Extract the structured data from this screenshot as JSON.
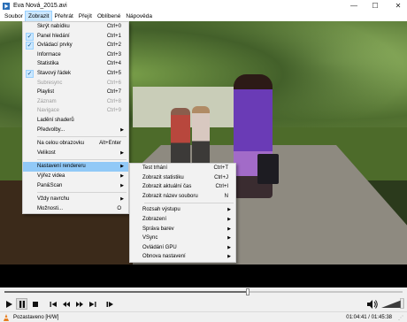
{
  "window": {
    "title": "Eva Nová_2015.avi",
    "minimize": "—",
    "maximize": "☐",
    "close": "✕"
  },
  "menubar": [
    "Soubor",
    "Zobrazit",
    "Přehrát",
    "Přejít",
    "Oblíbené",
    "Nápověda"
  ],
  "main_menu": [
    {
      "label": "Skrýt nabídku",
      "shortcut": "Ctrl+0"
    },
    {
      "label": "Panel hledání",
      "shortcut": "Ctrl+1",
      "checked": true
    },
    {
      "label": "Ovládací prvky",
      "shortcut": "Ctrl+2",
      "checked": true
    },
    {
      "label": "Informace",
      "shortcut": "Ctrl+3"
    },
    {
      "label": "Statistika",
      "shortcut": "Ctrl+4"
    },
    {
      "label": "Stavový řádek",
      "shortcut": "Ctrl+5",
      "checked": true
    },
    {
      "label": "Subresync",
      "shortcut": "Ctrl+6",
      "disabled": true
    },
    {
      "label": "Playlist",
      "shortcut": "Ctrl+7"
    },
    {
      "label": "Záznam",
      "shortcut": "Ctrl+8",
      "disabled": true
    },
    {
      "label": "Navigace",
      "shortcut": "Ctrl+9",
      "disabled": true
    },
    {
      "label": "Ladění shaderů"
    },
    {
      "label": "Předvolby...",
      "submenu": true
    },
    {
      "separator": true
    },
    {
      "label": "Na celou obrazovku",
      "shortcut": "Alt+Enter"
    },
    {
      "label": "Velikost",
      "submenu": true
    },
    {
      "separator": true
    },
    {
      "label": "Nastavení rendereru",
      "submenu": true,
      "highlighted": true
    },
    {
      "label": "Výřez videa",
      "submenu": true
    },
    {
      "label": "Pan&Scan",
      "submenu": true
    },
    {
      "separator": true
    },
    {
      "label": "Vždy navrchu",
      "submenu": true
    },
    {
      "label": "Možnosti...",
      "shortcut": "O"
    }
  ],
  "renderer_menu": [
    {
      "label": "Test trhání",
      "shortcut": "Ctrl+T"
    },
    {
      "label": "Zobrazit statistiku",
      "shortcut": "Ctrl+J"
    },
    {
      "label": "Zobrazit aktuální čas",
      "shortcut": "Ctrl+I"
    },
    {
      "label": "Zobrazit název souboru",
      "shortcut": "N"
    },
    {
      "separator": true
    },
    {
      "label": "Rozsah výstupu",
      "submenu": true
    },
    {
      "label": "Zobrazení",
      "submenu": true
    },
    {
      "label": "Správa barev",
      "submenu": true
    },
    {
      "label": "VSync",
      "submenu": true
    },
    {
      "label": "Ovládání GPU",
      "submenu": true
    },
    {
      "label": "Obnova nastavení",
      "submenu": true
    }
  ],
  "player": {
    "progress": 0.61,
    "volume": 0.9,
    "status_text": "Pozastaveno [H/W]",
    "time_display": "01:04:41 / 01:45:38",
    "controls": [
      "play-icon",
      "pause-icon",
      "stop-icon",
      "prev-icon",
      "rewind-icon",
      "forward-icon",
      "next-icon",
      "frame-step-icon"
    ]
  },
  "colors": {
    "highlight": "#91c9f7",
    "menu_bg": "#f2f2f2",
    "active_menu": "#cce8ff"
  }
}
